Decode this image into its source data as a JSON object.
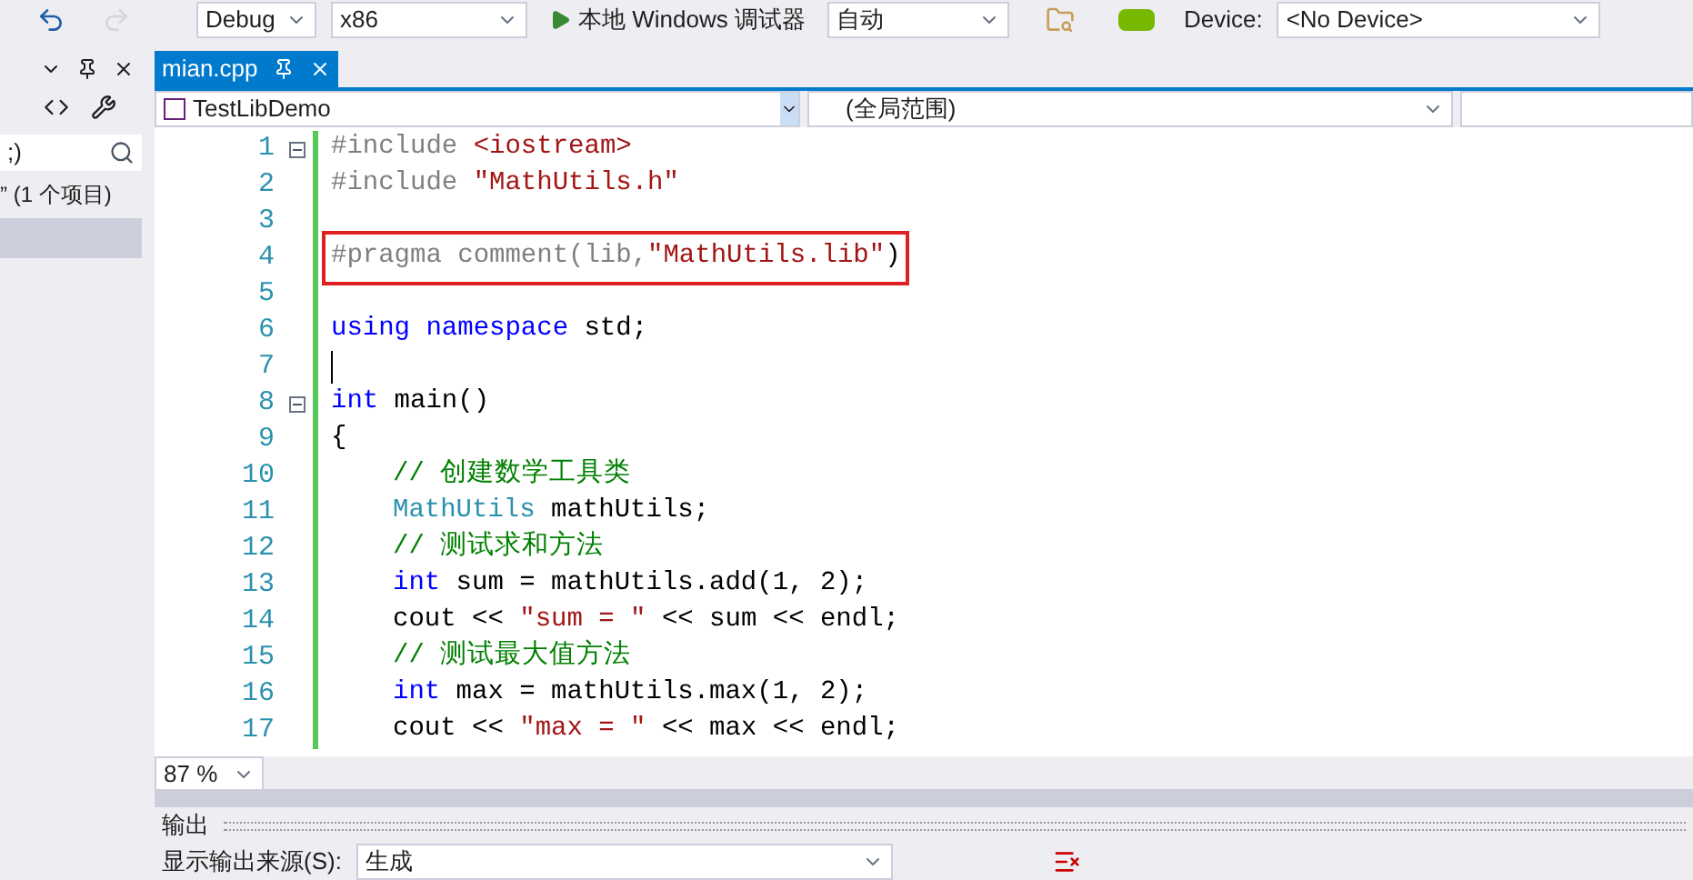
{
  "toolbar": {
    "config": "Debug",
    "platform": "x86",
    "run_label": "本地 Windows 调试器",
    "run_mode": "自动",
    "device_label": "Device:",
    "device": "<No Device>"
  },
  "side_panel": {
    "search_value": ";)",
    "item_text": "” (1 个项目)"
  },
  "tab": {
    "title": "mian.cpp",
    "selected": true
  },
  "nav": {
    "project": "TestLibDemo",
    "scope": "(全局范围)"
  },
  "code_lines": [
    {
      "number": "1",
      "fold": true,
      "highlight": false,
      "caret": false,
      "indent": false,
      "tokens": [
        {
          "kind": "pre",
          "text": "#include "
        },
        {
          "kind": "str",
          "text": "<iostream>"
        }
      ]
    },
    {
      "number": "2",
      "fold": false,
      "highlight": false,
      "caret": false,
      "indent": false,
      "tokens": [
        {
          "kind": "pre",
          "text": "#include "
        },
        {
          "kind": "str",
          "text": "\"MathUtils.h\""
        }
      ]
    },
    {
      "number": "3",
      "fold": false,
      "highlight": false,
      "caret": false,
      "indent": false
    },
    {
      "number": "4",
      "fold": false,
      "highlight": true,
      "caret": false,
      "indent": false,
      "tokens": [
        {
          "kind": "pre",
          "text": "#pragma comment(lib,"
        },
        {
          "kind": "str",
          "text": "\"MathUtils.lib\""
        },
        {
          "kind": "plain",
          "text": ")"
        }
      ]
    },
    {
      "number": "5",
      "fold": false,
      "highlight": false,
      "caret": false,
      "indent": false
    },
    {
      "number": "6",
      "fold": false,
      "highlight": false,
      "caret": false,
      "indent": false,
      "tokens": [
        {
          "kind": "kw",
          "text": "using namespace"
        },
        {
          "kind": "plain",
          "text": " std;"
        }
      ]
    },
    {
      "number": "7",
      "fold": false,
      "highlight": false,
      "caret": true,
      "indent": false
    },
    {
      "number": "8",
      "fold": true,
      "highlight": false,
      "caret": false,
      "indent": false,
      "tokens": [
        {
          "kind": "kw",
          "text": "int"
        },
        {
          "kind": "plain",
          "text": " main()"
        }
      ]
    },
    {
      "number": "9",
      "fold": false,
      "highlight": false,
      "caret": false,
      "indent": false,
      "tokens": [
        {
          "kind": "plain",
          "text": "{"
        }
      ]
    },
    {
      "number": "10",
      "fold": false,
      "highlight": false,
      "caret": false,
      "indent": true,
      "tokens": [
        {
          "kind": "cmt",
          "text": "// 创建数学工具类"
        }
      ]
    },
    {
      "number": "11",
      "fold": false,
      "highlight": false,
      "caret": false,
      "indent": true,
      "tokens": [
        {
          "kind": "type",
          "text": "MathUtils"
        },
        {
          "kind": "plain",
          "text": " mathUtils;"
        }
      ]
    },
    {
      "number": "12",
      "fold": false,
      "highlight": false,
      "caret": false,
      "indent": true,
      "tokens": [
        {
          "kind": "cmt",
          "text": "// 测试求和方法"
        }
      ]
    },
    {
      "number": "13",
      "fold": false,
      "highlight": false,
      "caret": false,
      "indent": true,
      "tokens": [
        {
          "kind": "kw",
          "text": "int"
        },
        {
          "kind": "plain",
          "text": " sum = mathUtils.add(1, 2);"
        }
      ]
    },
    {
      "number": "14",
      "fold": false,
      "highlight": false,
      "caret": false,
      "indent": true,
      "tokens": [
        {
          "kind": "plain",
          "text": "cout << "
        },
        {
          "kind": "str",
          "text": "\"sum = \""
        },
        {
          "kind": "plain",
          "text": " << sum << endl;"
        }
      ]
    },
    {
      "number": "15",
      "fold": false,
      "highlight": false,
      "caret": false,
      "indent": true,
      "tokens": [
        {
          "kind": "cmt",
          "text": "// 测试最大值方法"
        }
      ]
    },
    {
      "number": "16",
      "fold": false,
      "highlight": false,
      "caret": false,
      "indent": true,
      "tokens": [
        {
          "kind": "kw",
          "text": "int"
        },
        {
          "kind": "plain",
          "text": " max = mathUtils.max(1, 2);"
        }
      ]
    },
    {
      "number": "17",
      "fold": false,
      "highlight": false,
      "caret": false,
      "indent": true,
      "tokens": [
        {
          "kind": "plain",
          "text": "cout << "
        },
        {
          "kind": "str",
          "text": "\"max = \""
        },
        {
          "kind": "plain",
          "text": " << max << endl;"
        }
      ]
    }
  ],
  "zoom": "87 %",
  "output": {
    "title": "输出",
    "source_label": "显示输出来源(S):",
    "source": "生成"
  }
}
